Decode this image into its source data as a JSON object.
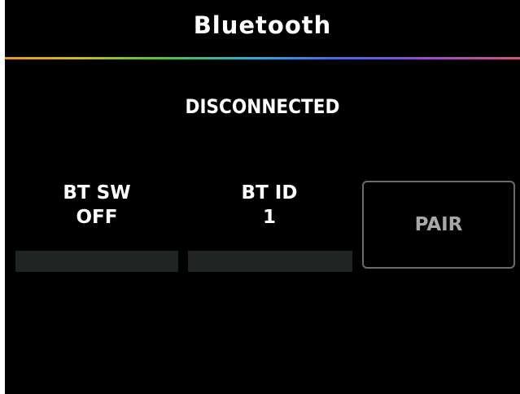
{
  "screen": {
    "title": "Bluetooth",
    "status": "DISCONNECTED"
  },
  "parameters": [
    {
      "label": "BT SW",
      "value": "OFF"
    },
    {
      "label": "BT ID",
      "value": "1"
    }
  ],
  "pair_button": {
    "label": "PAIR",
    "enabled": false
  },
  "colors": {
    "background": "#000000",
    "text": "#ffffff",
    "disabled_text": "#a8a8a8",
    "value_bar": "#202423"
  }
}
